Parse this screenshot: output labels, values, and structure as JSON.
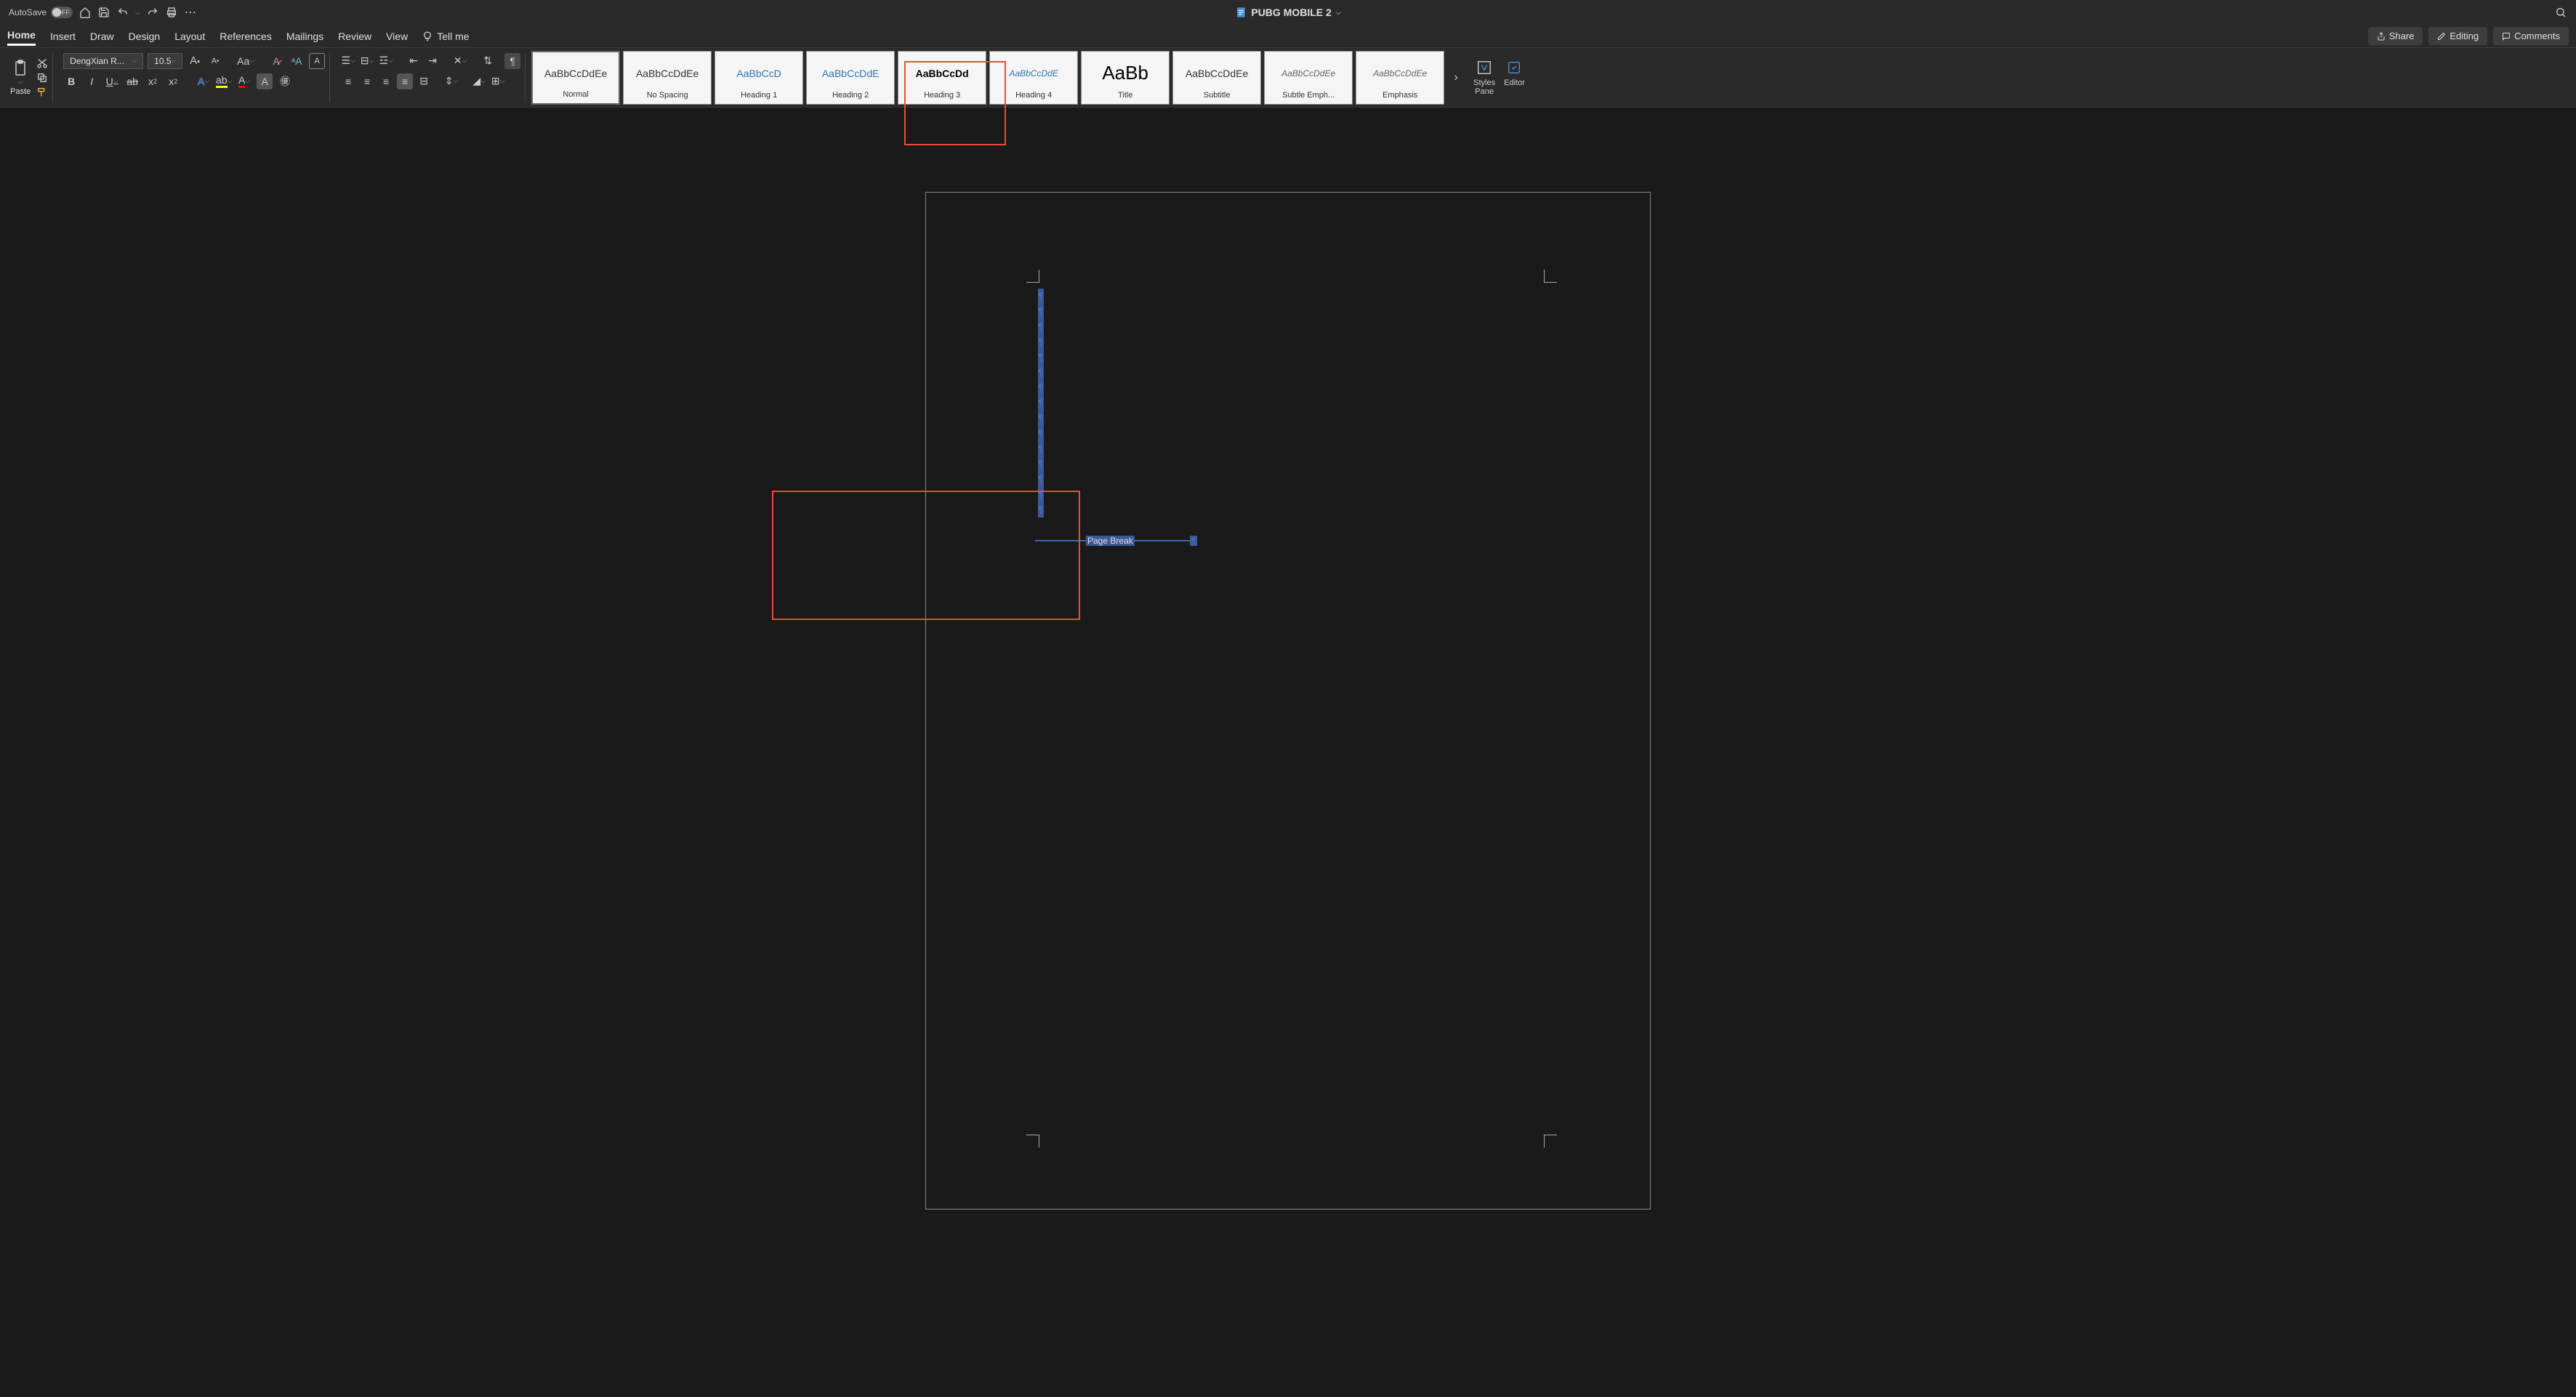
{
  "titlebar": {
    "autosave_label": "AutoSave",
    "autosave_state": "OFF",
    "document_title": "PUBG MOBILE 2"
  },
  "menu": {
    "tabs": [
      "Home",
      "Insert",
      "Draw",
      "Design",
      "Layout",
      "References",
      "Mailings",
      "Review",
      "View"
    ],
    "active_tab": "Home",
    "tell_me": "Tell me",
    "share": "Share",
    "editing": "Editing",
    "comments": "Comments"
  },
  "ribbon": {
    "paste": "Paste",
    "font_name": "DengXian R...",
    "font_size": "10.5",
    "styles": [
      {
        "preview": "AaBbCcDdEe",
        "name": "Normal",
        "cls": ""
      },
      {
        "preview": "AaBbCcDdEe",
        "name": "No Spacing",
        "cls": ""
      },
      {
        "preview": "AaBbCcD",
        "name": "Heading 1",
        "cls": "blue"
      },
      {
        "preview": "AaBbCcDdE",
        "name": "Heading 2",
        "cls": "blue"
      },
      {
        "preview": "AaBbCcDd",
        "name": "Heading 3",
        "cls": "boldblack"
      },
      {
        "preview": "AaBbCcDdE",
        "name": "Heading 4",
        "cls": "italicblue"
      },
      {
        "preview": "AaBb",
        "name": "Title",
        "cls": "title"
      },
      {
        "preview": "AaBbCcDdEe",
        "name": "Subtitle",
        "cls": ""
      },
      {
        "preview": "AaBbCcDdEe",
        "name": "Subtle Emph...",
        "cls": "italicgray"
      },
      {
        "preview": "AaBbCcDdEe",
        "name": "Emphasis",
        "cls": "italicgray"
      }
    ],
    "styles_pane": "Styles\nPane",
    "editor": "Editor"
  },
  "document": {
    "page_break": "Page Break"
  }
}
